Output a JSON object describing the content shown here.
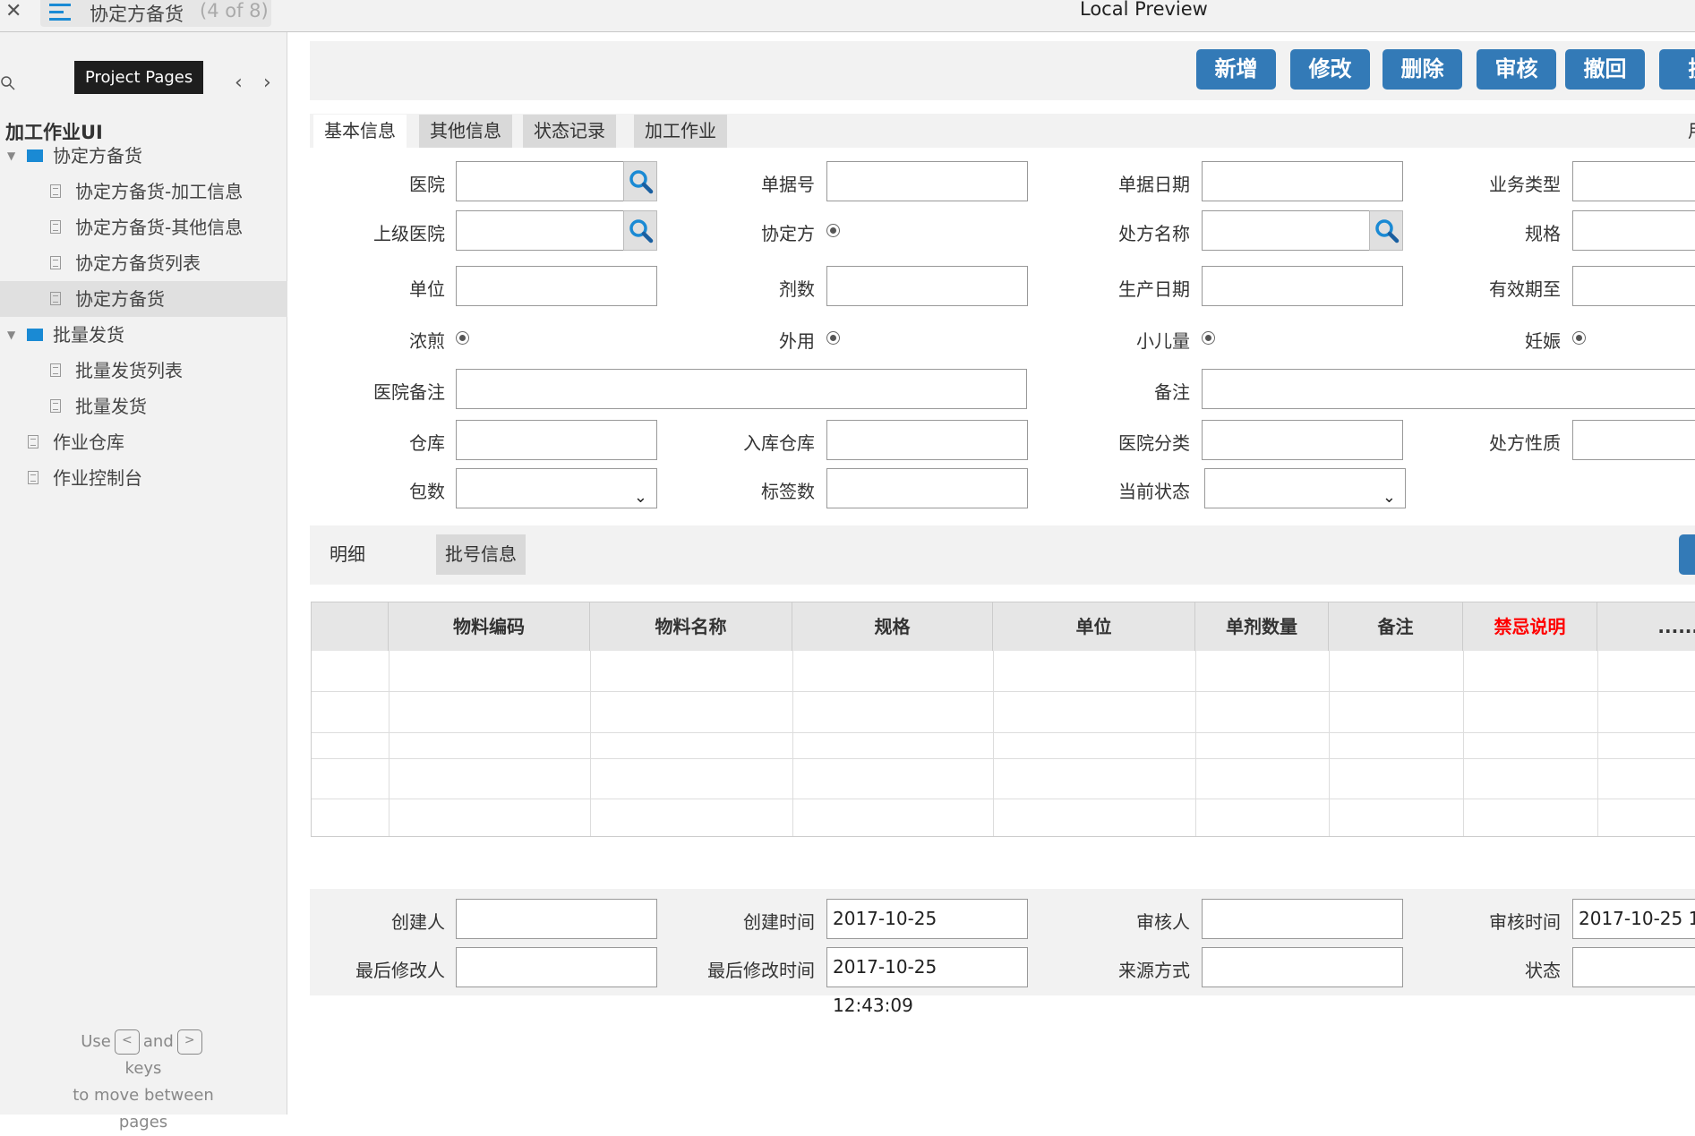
{
  "topbar": {
    "close": "✕",
    "page_name": "协定方备货",
    "page_count": "(4 of 8)",
    "preview_title": "Local Preview",
    "tooltip": "Project Pages"
  },
  "sidebar": {
    "project_title": "加工作业UI",
    "items": [
      {
        "label": "协定方备货",
        "type": "folder",
        "level": 0
      },
      {
        "label": "协定方备货-加工信息",
        "type": "page",
        "level": 1
      },
      {
        "label": "协定方备货-其他信息",
        "type": "page",
        "level": 1
      },
      {
        "label": "协定方备货列表",
        "type": "page",
        "level": 1
      },
      {
        "label": "协定方备货",
        "type": "page",
        "level": 1,
        "selected": true
      },
      {
        "label": "批量发货",
        "type": "folder",
        "level": 0
      },
      {
        "label": "批量发货列表",
        "type": "page",
        "level": 1
      },
      {
        "label": "批量发货",
        "type": "page",
        "level": 1
      },
      {
        "label": "作业仓库",
        "type": "page",
        "level": 0
      },
      {
        "label": "作业控制台",
        "type": "page",
        "level": 0
      }
    ],
    "hint": {
      "use": "Use",
      "and": "and",
      "keys": "keys",
      "move": "to move between",
      "pages": "pages",
      "prev_key": "<",
      "next_key": ">"
    }
  },
  "toolbar": {
    "buttons": [
      "新增",
      "修改",
      "删除",
      "审核",
      "撤回",
      "提"
    ]
  },
  "tabs": [
    "基本信息",
    "其他信息",
    "状态记录",
    "加工作业"
  ],
  "tabs_right_partial": "用",
  "form": {
    "hospital": "医院",
    "doc_no": "单据号",
    "doc_date": "单据日期",
    "biz_type": "业务类型",
    "parent_hospital": "上级医院",
    "agreement": "协定方",
    "rx_name": "处方名称",
    "spec": "规格",
    "unit": "单位",
    "doses": "剂数",
    "prod_date": "生产日期",
    "expiry": "有效期至",
    "concentrate": "浓煎",
    "external": "外用",
    "child_dose": "小儿量",
    "pregnancy": "妊娠",
    "hospital_note": "医院备注",
    "note": "备注",
    "warehouse": "仓库",
    "in_warehouse": "入库仓库",
    "hospital_class": "医院分类",
    "rx_nature": "处方性质",
    "packs": "包数",
    "labels": "标签数",
    "current_status": "当前状态"
  },
  "detail": {
    "tabs": [
      "明细",
      "批号信息"
    ],
    "columns": [
      "",
      "物料编码",
      "物料名称",
      "规格",
      "单位",
      "单剂数量",
      "备注",
      "禁忌说明",
      "......"
    ],
    "highlight_color": "#ff0000"
  },
  "footer": {
    "creator": "创建人",
    "create_time": "创建时间",
    "create_time_value": "2017-10-25 12:43:09",
    "auditor": "审核人",
    "audit_time": "审核时间",
    "audit_time_value": "2017-10-25 1",
    "modifier": "最后修改人",
    "modify_time": "最后修改时间",
    "modify_time_value": "2017-10-25 12:43:09",
    "source": "来源方式",
    "status": "状态"
  },
  "colors": {
    "accent": "#337ab7",
    "folder": "#1a8ad4"
  }
}
